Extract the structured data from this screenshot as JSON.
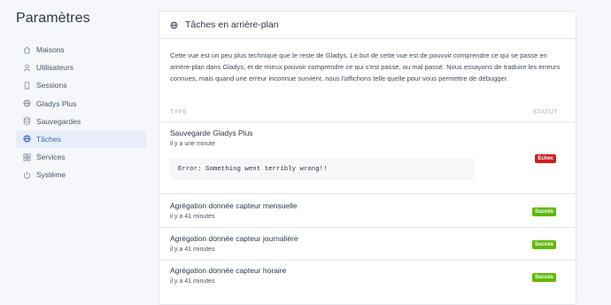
{
  "sidebar": {
    "title": "Paramètres",
    "items": [
      {
        "label": "Maisons",
        "icon": "home-icon"
      },
      {
        "label": "Utilisateurs",
        "icon": "user-icon"
      },
      {
        "label": "Sessions",
        "icon": "phone-icon"
      },
      {
        "label": "Gladys Plus",
        "icon": "globe-icon"
      },
      {
        "label": "Sauvegardes",
        "icon": "database-icon"
      },
      {
        "label": "Tâches",
        "icon": "globe-icon",
        "active": true
      },
      {
        "label": "Services",
        "icon": "grid-icon"
      },
      {
        "label": "Système",
        "icon": "power-icon"
      }
    ]
  },
  "card": {
    "title": "Tâches en arrière-plan",
    "description": "Cette vue est un peu plus technique que le reste de Gladys. Le but de cette vue est de pouvoir comprendre ce qui se passe en arrière-plan dans Gladys, et de mieux pouvoir comprendre ce qui s'est passé, ou mal passé. Nous essayons de traduire les erreurs connues, mais quand une erreur inconnue survient, nous l'affichons telle quelle pour vous permettre de débugger.",
    "columns": {
      "type": "TYPE",
      "status": "STATUT"
    },
    "jobs": [
      {
        "name": "Sauvegarde Gladys Plus",
        "time": "il y a une minute",
        "status": "Echec",
        "error": "Error: Something went terribly wrong!!"
      },
      {
        "name": "Agrégation donnée capteur mensuelle",
        "time": "il y a 41 minutes",
        "status": "Succès"
      },
      {
        "name": "Agrégation donnée capteur journalière",
        "time": "il y a 41 minutes",
        "status": "Succès"
      },
      {
        "name": "Agrégation donnée capteur horaire",
        "time": "il y a 41 minutes",
        "status": "Succès"
      }
    ]
  },
  "colors": {
    "accent": "#3b6fb6",
    "failure": "#cd201f",
    "success": "#5eba00"
  }
}
